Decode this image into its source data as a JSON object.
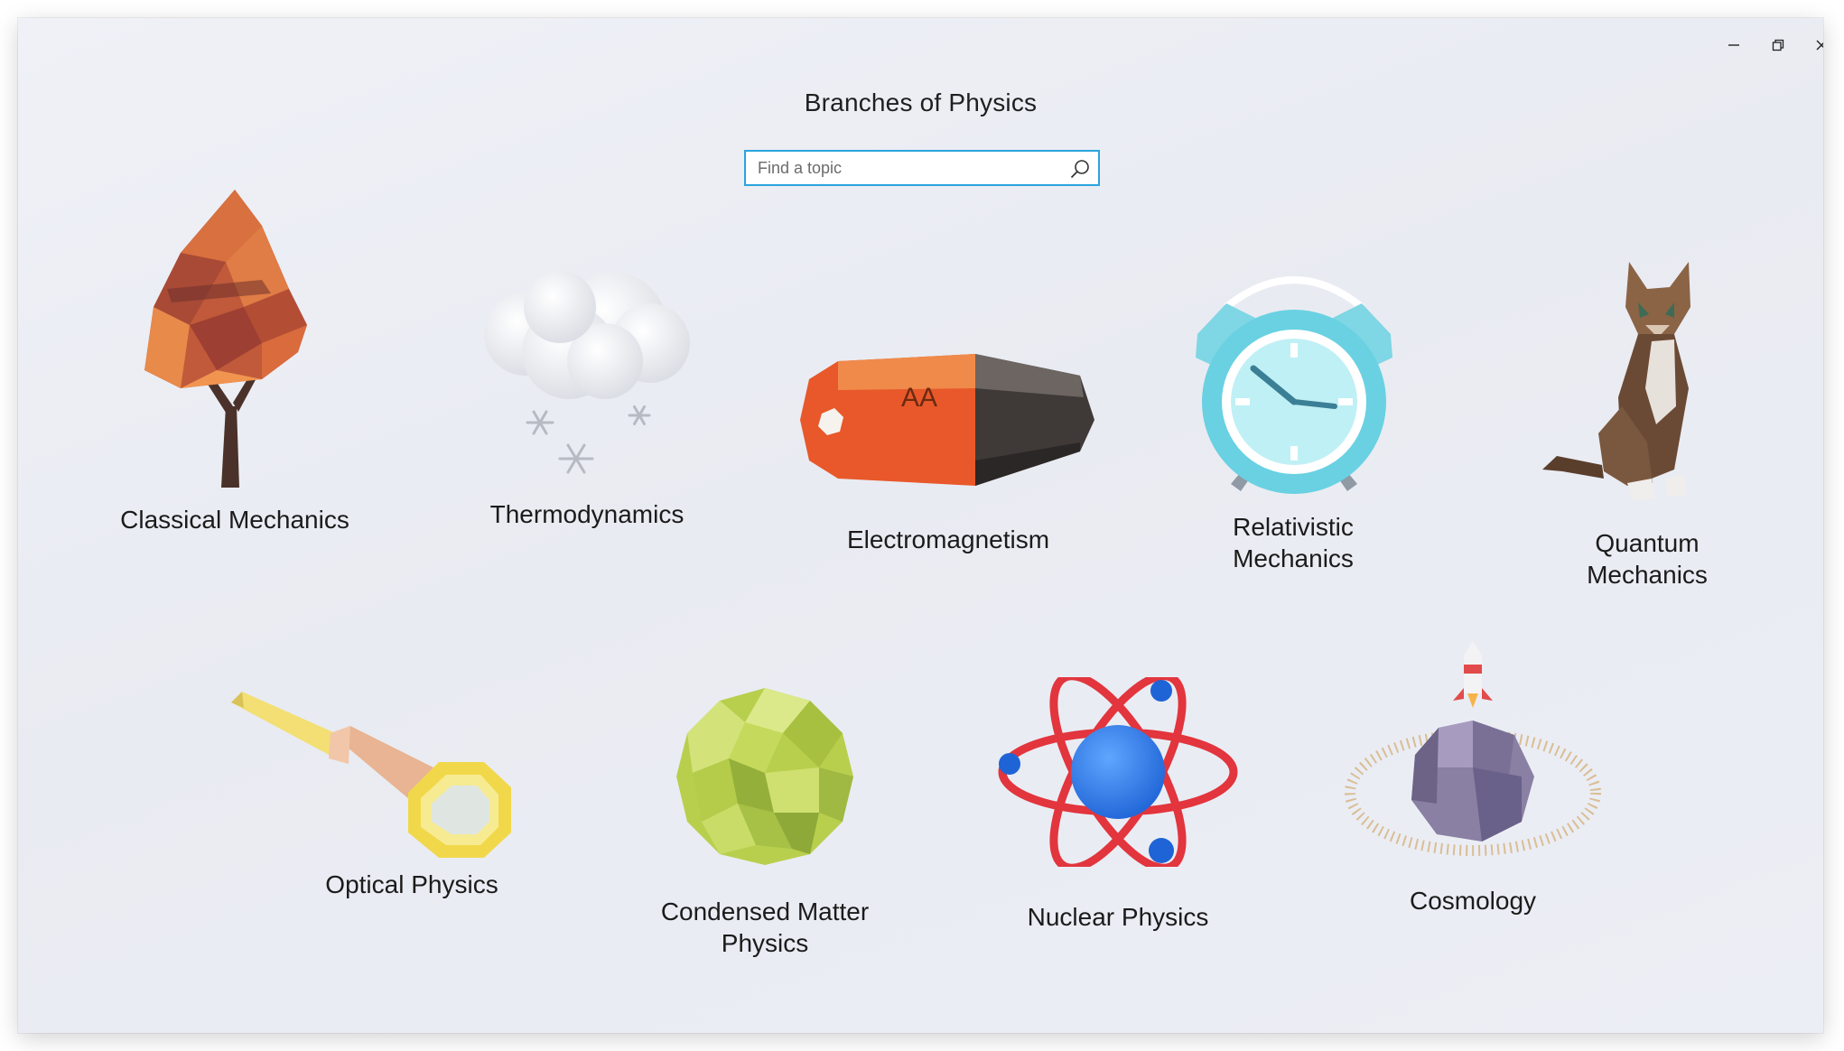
{
  "window": {
    "title": "Branches of Physics",
    "controls": {
      "minimize": "minimize",
      "restore": "restore",
      "close": "close"
    }
  },
  "search": {
    "placeholder": "Find a topic",
    "value": ""
  },
  "topics": [
    {
      "label": "Classical Mechanics",
      "icon": "tree-icon"
    },
    {
      "label": "Thermodynamics",
      "icon": "snow-cloud-icon"
    },
    {
      "label": "Electromagnetism",
      "icon": "battery-icon",
      "battery_text": "AA"
    },
    {
      "label": "Relativistic Mechanics",
      "icon": "alarm-clock-icon"
    },
    {
      "label": "Quantum Mechanics",
      "icon": "cat-icon"
    },
    {
      "label": "Optical Physics",
      "icon": "telescope-icon"
    },
    {
      "label": "Condensed Matter Physics",
      "icon": "crystal-sphere-icon"
    },
    {
      "label": "Nuclear Physics",
      "icon": "atom-icon"
    },
    {
      "label": "Cosmology",
      "icon": "planet-rocket-icon"
    }
  ],
  "colors": {
    "accent": "#2aa4dd",
    "background": "#eceef5",
    "text": "#1b1b1b"
  }
}
